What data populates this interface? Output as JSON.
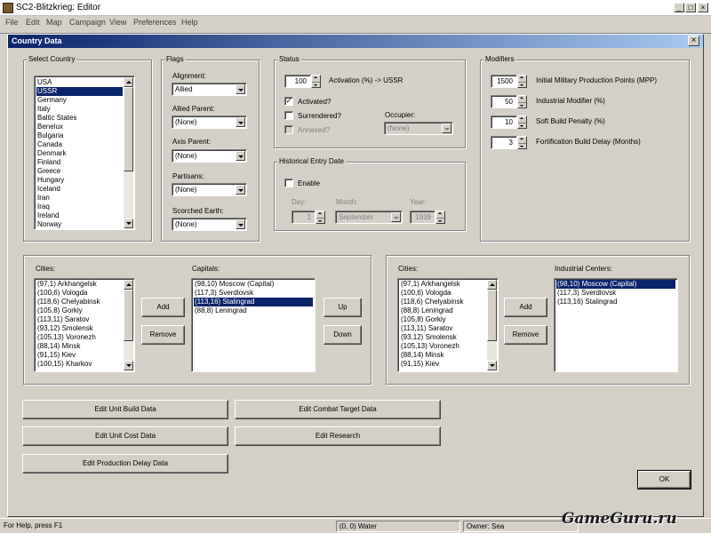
{
  "app": {
    "title": "SC2-Blitzkrieg: Editor",
    "window_buttons": [
      "_",
      "□",
      "×"
    ],
    "menu": [
      "File",
      "Edit",
      "Map",
      "Campaign",
      "View",
      "Preferences",
      "Help"
    ]
  },
  "dialog": {
    "title": "Country Data",
    "close_label": "×",
    "select_country": {
      "label": "Select Country",
      "items": [
        "USA",
        "USSR",
        "Germany",
        "Italy",
        "Baltic States",
        "Benelux",
        "Bulgaria",
        "Canada",
        "Denmark",
        "Finland",
        "Greece",
        "Hungary",
        "Iceland",
        "Iran",
        "Iraq",
        "Ireland",
        "Norway"
      ],
      "selected": "USSR"
    },
    "flags": {
      "label": "Flags",
      "alignment_label": "Alignment:",
      "alignment_value": "Allied",
      "allied_parent_label": "Allied Parent:",
      "allied_parent_value": "(None)",
      "axis_parent_label": "Axis Parent:",
      "axis_parent_value": "(None)",
      "partisans_label": "Partisans:",
      "partisans_value": "(None)",
      "scorched_label": "Scorched Earth:",
      "scorched_value": "(None)"
    },
    "status": {
      "label": "Status",
      "activation_value": "100",
      "activation_text": "Activation (%) -> USSR",
      "activated_label": "Activated?",
      "activated_checked": true,
      "surrendered_label": "Surrendered?",
      "surrendered_checked": false,
      "annexed_label": "Annexed?",
      "annexed_checked": false,
      "occupier_label": "Occupier:",
      "occupier_value": "(None)"
    },
    "historical_entry": {
      "label": "Historical Entry Date",
      "enable_label": "Enable",
      "enable_checked": false,
      "day_label": "Day:",
      "day_value": "1",
      "month_label": "Month:",
      "month_value": "September",
      "year_label": "Year:",
      "year_value": "1939"
    },
    "modifiers": {
      "label": "Modifiers",
      "mpp_value": "1500",
      "mpp_label": "Initial Military Production Points (MPP)",
      "industrial_value": "50",
      "industrial_label": "Industrial Modifier (%)",
      "soft_value": "10",
      "soft_label": "Soft Build Penalty (%)",
      "fort_value": "3",
      "fort_label": "Fortification Build Delay (Months)"
    },
    "capitals_panel": {
      "cities_label": "Cities:",
      "cities": [
        "(97,1) Arkhangelsk",
        "(100,6) Vologda",
        "(118,6) Chelyabinsk",
        "(105,8) Gorkiy",
        "(113,11) Saratov",
        "(93,12) Smolensk",
        "(105,13) Voronezh",
        "(88,14) Minsk",
        "(91,15) Kiev",
        "(100,15) Kharkov"
      ],
      "add_label": "Add",
      "remove_label": "Remove",
      "capitals_label": "Capitals:",
      "capitals": [
        "(98,10) Moscow (Capital)",
        "(117,3) Sverdlovsk",
        "(113,16) Stalingrad",
        "(88,8) Leningrad"
      ],
      "capitals_selected": "(113,16) Stalingrad",
      "up_label": "Up",
      "down_label": "Down"
    },
    "industrial_panel": {
      "cities_label": "Cities:",
      "cities": [
        "(97,1) Arkhangelsk",
        "(100,6) Vologda",
        "(118,6) Chelyabinsk",
        "(88,8) Leningrad",
        "(105,8) Gorkiy",
        "(113,11) Saratov",
        "(93,12) Smolensk",
        "(105,13) Voronezh",
        "(88,14) Minsk",
        "(91,15) Kiev"
      ],
      "add_label": "Add",
      "remove_label": "Remove",
      "centers_label": "Industrial Centers:",
      "centers": [
        "(98,10) Moscow (Capital)",
        "(117,3) Sverdlovsk",
        "(113,16) Stalingrad"
      ],
      "centers_selected": "(98,10) Moscow (Capital)"
    },
    "buttons": {
      "unit_build": "Edit Unit Build Data",
      "combat_target": "Edit Combat Target Data",
      "unit_cost": "Edit Unit Cost Data",
      "research": "Edit Research",
      "production_delay": "Edit Production Delay Data",
      "ok": "OK"
    }
  },
  "statusbar": {
    "help": "For Help, press F1",
    "coords": "(0, 0) Water",
    "owner": "Owner:  Sea"
  },
  "watermark": "GameGuru.ru"
}
